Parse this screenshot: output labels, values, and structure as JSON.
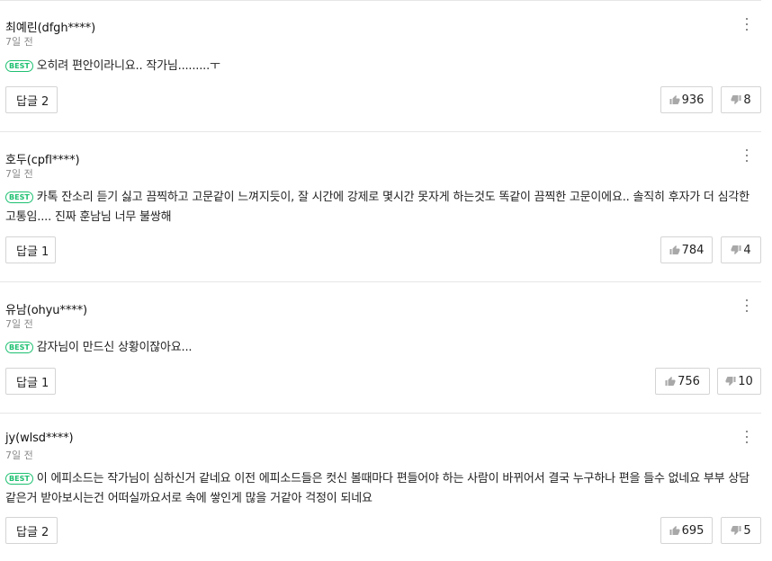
{
  "comments": [
    {
      "author": "최예린(dfgh****)",
      "date": "7일 전",
      "badge": "BEST",
      "text": "오히려 편안이라니요.. 작가님.........ㅜ",
      "reply_label": "답글 2",
      "likes": "936",
      "dislikes": "8"
    },
    {
      "author": "호두(cpfl****)",
      "date": "7일 전",
      "badge": "BEST",
      "text": "카톡 잔소리 듣기 싫고 끔찍하고 고문같이 느껴지듯이, 잘 시간에 강제로 몇시간 못자게 하는것도 똑같이 끔찍한 고문이에요.. 솔직히 후자가 더 심각한 고통임.... 진짜 훈남님 너무 불쌍해",
      "reply_label": "답글 1",
      "likes": "784",
      "dislikes": "4"
    },
    {
      "author": "유남(ohyu****)",
      "date": "7일 전",
      "badge": "BEST",
      "text": "감자님이 만드신 상황이잖아요...",
      "reply_label": "답글 1",
      "likes": "756",
      "dislikes": "10"
    },
    {
      "author": "jy(wlsd****)",
      "date": "7일 전",
      "badge": "BEST",
      "text": "이 에피소드는 작가님이 심하신거 같네요 이전 에피소드들은 컷신 볼때마다 편들어야 하는 사람이 바뀌어서 결국 누구하나 편을 들수 없네요 부부 상담 같은거 받아보시는건 어떠실까요서로 속에 쌓인게 많을 거같아 걱정이 되네요",
      "reply_label": "답글 2",
      "likes": "695",
      "dislikes": "5"
    }
  ],
  "icons": {
    "more": "more-vertical-icon",
    "like": "thumbs-up-icon",
    "dislike": "thumbs-down-icon"
  },
  "colors": {
    "best_badge": "#1ec071",
    "date_text": "#8a8a8a",
    "icon_gray": "#a8a8a8",
    "border": "#d4d4d4",
    "divider": "#e6e6e6"
  }
}
